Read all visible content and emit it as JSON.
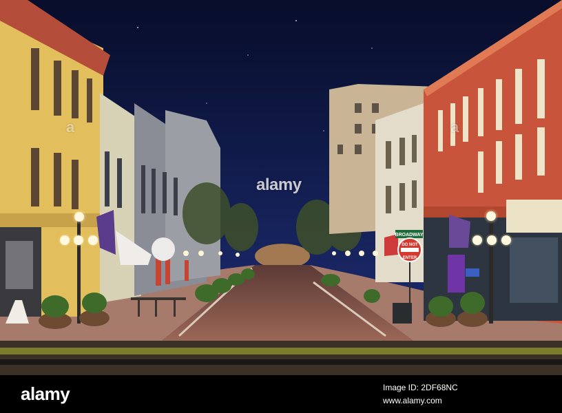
{
  "photo": {
    "signs": {
      "street_sign": "BROADWAY",
      "do_not_line1": "DO NOT",
      "do_not_line2": "ENTER"
    },
    "colors": {
      "sky_top": "#0b1336",
      "sky_bottom": "#1b2a6e",
      "yellow_building": "#e9cc6b",
      "red_brick": "#c5543a",
      "street": "#8c5a4c"
    }
  },
  "watermark": {
    "center": "alamy",
    "left": "a",
    "right": "a"
  },
  "footer": {
    "brand": "alamy",
    "image_id": "Image ID: 2DF68NC",
    "site": "www.alamy.com"
  }
}
